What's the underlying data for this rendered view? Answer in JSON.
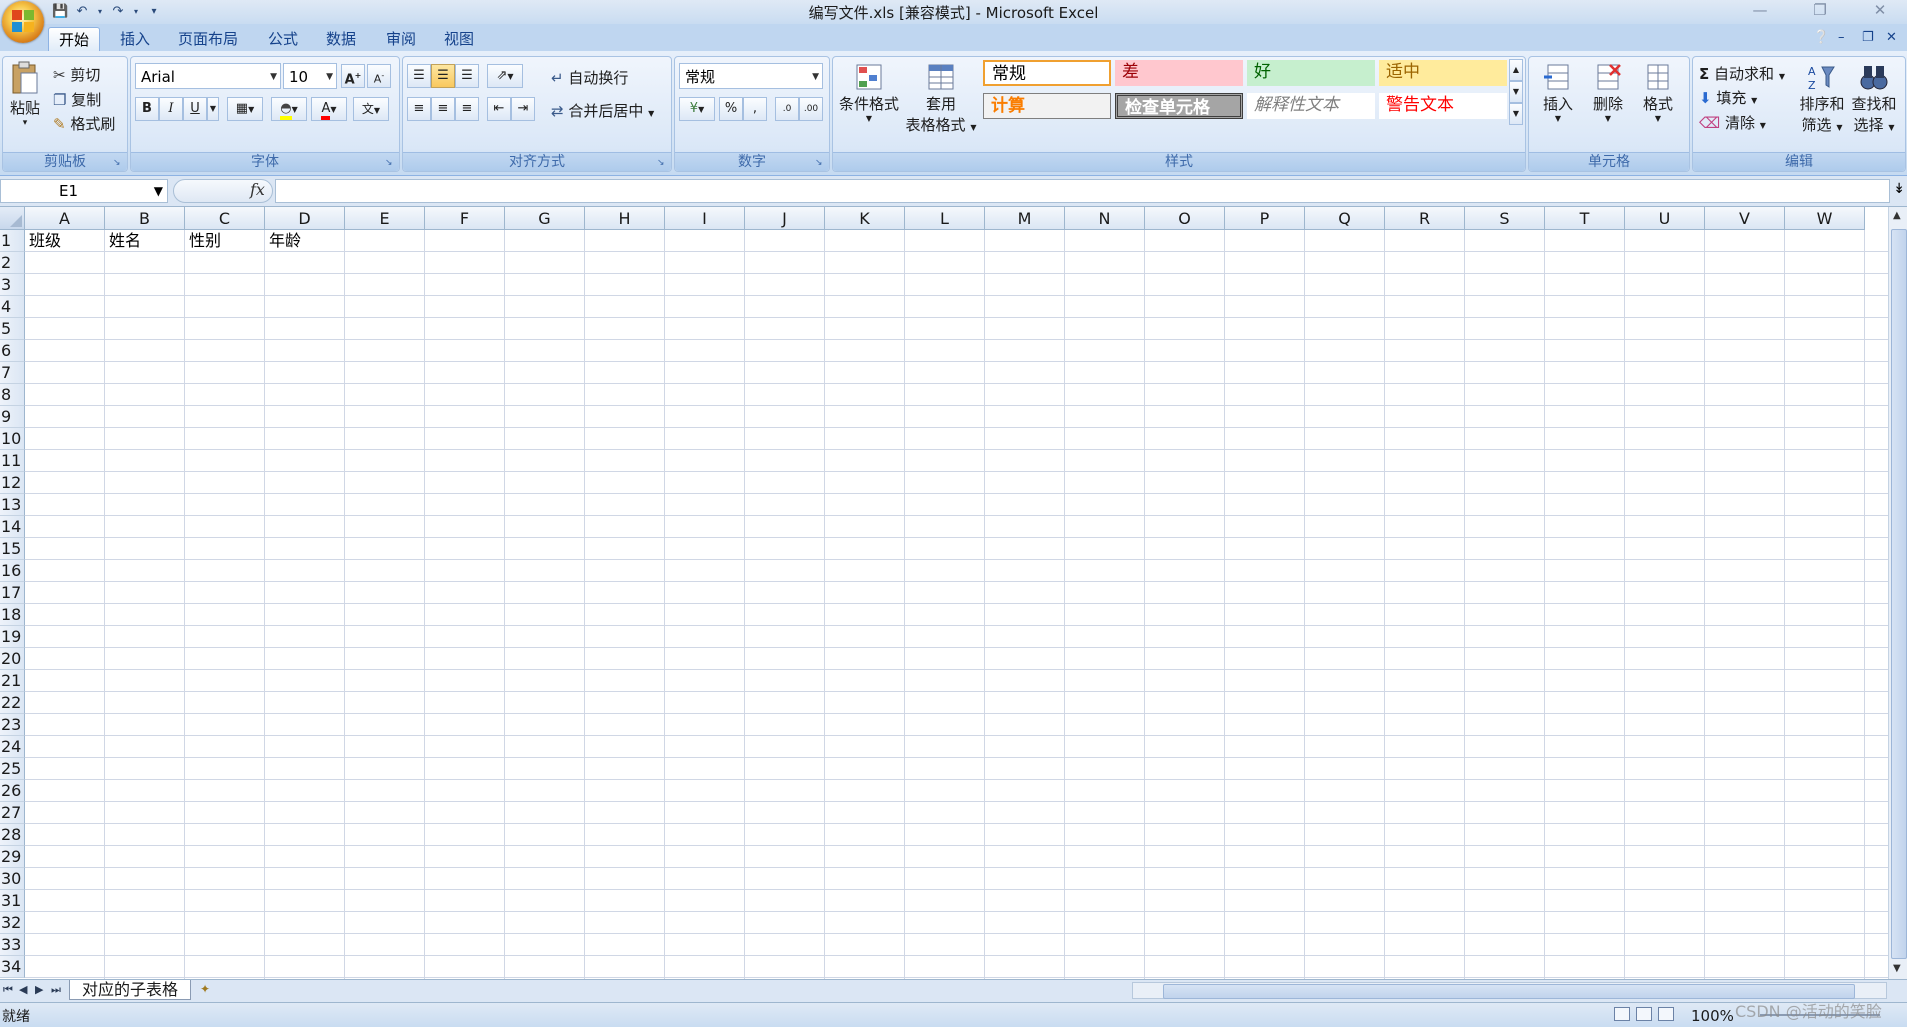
{
  "window": {
    "title": "编写文件.xls  [兼容模式] - Microsoft Excel"
  },
  "quick_access": {
    "save_icon": "save-icon",
    "undo_icon": "undo-icon",
    "redo_icon": "redo-icon"
  },
  "tabs": [
    "开始",
    "插入",
    "页面布局",
    "公式",
    "数据",
    "审阅",
    "视图"
  ],
  "ribbon": {
    "clipboard": {
      "label": "剪贴板",
      "paste": "粘贴",
      "cut": "剪切",
      "copy": "复制",
      "format_painter": "格式刷"
    },
    "font": {
      "label": "字体",
      "font_name": "Arial",
      "font_size": "10"
    },
    "alignment": {
      "label": "对齐方式",
      "wrap_text": "自动换行",
      "merge_center": "合并后居中"
    },
    "number": {
      "label": "数字",
      "format": "常规"
    },
    "styles": {
      "label": "样式",
      "conditional_format": "条件格式",
      "table_format_1": "套用",
      "table_format_2": "表格格式",
      "cells": [
        {
          "text": "常规",
          "fg": "#000000",
          "bg": "#ffffff"
        },
        {
          "text": "差",
          "fg": "#9c0006",
          "bg": "#ffc7ce"
        },
        {
          "text": "好",
          "fg": "#006100",
          "bg": "#c6efce"
        },
        {
          "text": "适中",
          "fg": "#9c6500",
          "bg": "#ffeb9c"
        },
        {
          "text": "计算",
          "fg": "#fa7d00",
          "bg": "#f2f2f2"
        },
        {
          "text": "检查单元格",
          "fg": "#ffffff",
          "bg": "#a5a5a5"
        },
        {
          "text": "解释性文本",
          "fg": "#7f7f7f",
          "bg": "#ffffff"
        },
        {
          "text": "警告文本",
          "fg": "#ff0000",
          "bg": "#ffffff"
        }
      ]
    },
    "cells_group": {
      "label": "单元格",
      "insert": "插入",
      "delete": "删除",
      "format": "格式"
    },
    "editing": {
      "label": "编辑",
      "autosum": "自动求和",
      "fill": "填充",
      "clear": "清除",
      "sort_filter_1": "排序和",
      "sort_filter_2": "筛选",
      "find_select_1": "查找和",
      "find_select_2": "选择"
    }
  },
  "formula_bar": {
    "name_box": "E1",
    "fx": "fx",
    "formula": ""
  },
  "grid": {
    "columns": [
      "A",
      "B",
      "C",
      "D",
      "E",
      "F",
      "G",
      "H",
      "I",
      "J",
      "K",
      "L",
      "M",
      "N",
      "O",
      "P",
      "Q",
      "R",
      "S",
      "T",
      "U",
      "V",
      "W"
    ],
    "rows": [
      "1",
      "2",
      "3",
      "4",
      "5",
      "6",
      "7",
      "8",
      "9",
      "10",
      "11",
      "12",
      "13",
      "14",
      "15",
      "16",
      "17",
      "18",
      "19",
      "20",
      "21",
      "22",
      "23",
      "24",
      "25",
      "26",
      "27",
      "28",
      "29",
      "30",
      "31",
      "32",
      "33",
      "34"
    ],
    "row1": [
      "班级",
      "姓名",
      "性别",
      "年龄"
    ]
  },
  "sheets": {
    "active": "对应的子表格"
  },
  "status": {
    "text": "就绪",
    "zoom": "100%"
  },
  "watermark": "CSDN @活动的笑脸"
}
